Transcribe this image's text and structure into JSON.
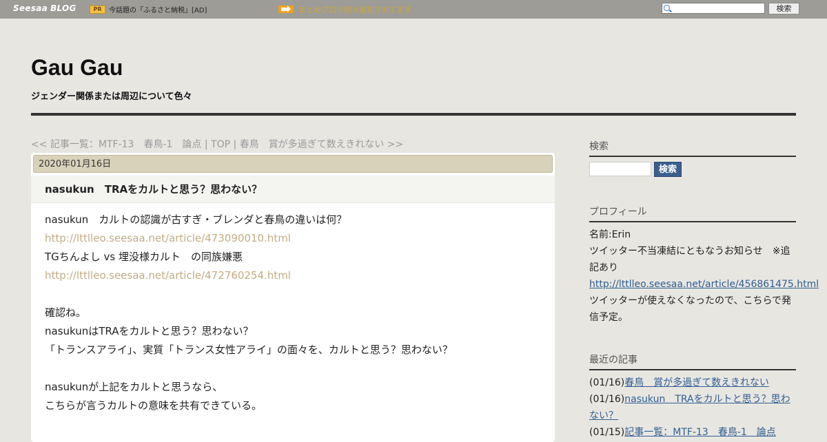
{
  "topbar": {
    "logo_seesaa": "Seesaa",
    "logo_blog": "BLOG",
    "pr_badge": "PR",
    "pr_text": "今話題の「ふるさと納税」[AD]",
    "notice_text": "まとめブログ続々追加されてます",
    "search_button": "検索"
  },
  "header": {
    "title": "Gau Gau",
    "description": "ジェンダー関係または周辺について色々"
  },
  "nav": {
    "prev": "<< 記事一覧：MTF-13　春鳥-1　論点",
    "sep1": " | ",
    "top": "TOP",
    "sep2": " | ",
    "next": "春鳥　賞が多過ぎて数えきれない >>"
  },
  "article": {
    "date": "2020年01月16日",
    "title": "nasukun　TRAをカルトと思う？思わない？",
    "lines": [
      "nasukun　カルトの認識が古すぎ・ブレンダと春鳥の違いは何？",
      "http://lttlleo.seesaa.net/article/473090010.html",
      "TGちんよし vs 埋没様カルト　の同族嫌悪",
      "http://lttlleo.seesaa.net/article/472760254.html",
      "",
      "確認ね。",
      "nasukunはTRAをカルトと思う？思わない？",
      "「トランスアライ」、実質「トランス女性アライ」の面々を、カルトと思う？思わない？",
      "",
      "nasukunが上記をカルトと思うなら、",
      "こちらが言うカルトの意味を共有できている。"
    ]
  },
  "sidebar": {
    "search_heading": "検索",
    "search_button": "検索",
    "profile_heading": "プロフィール",
    "profile_name": "名前:Erin",
    "profile_notice": "ツイッター不当凍結にともなうお知らせ　※追記あり",
    "profile_link": "http://lttlleo.seesaa.net/article/456861475.html",
    "profile_note": "ツイッターが使えなくなったので、こちらで発信予定。",
    "recent_heading": "最近の記事",
    "recent": [
      {
        "date": "(01/16)",
        "title": "春鳥　賞が多過ぎて数えきれない"
      },
      {
        "date": "(01/16)",
        "title": "nasukun　TRAをカルトと思う？思わない？"
      },
      {
        "date": "(01/15)",
        "title": "記事一覧：MTF-13　春鳥-1　論点"
      }
    ]
  },
  "colors": {
    "page_bg": "#e8e6e1",
    "topbar_bg": "#9d9c97",
    "date_bar_bg": "#d9d2bb",
    "article_link": "#c2ac82",
    "sidebar_link": "#2f5f93",
    "search_button_bg": "#3b5e8c"
  }
}
